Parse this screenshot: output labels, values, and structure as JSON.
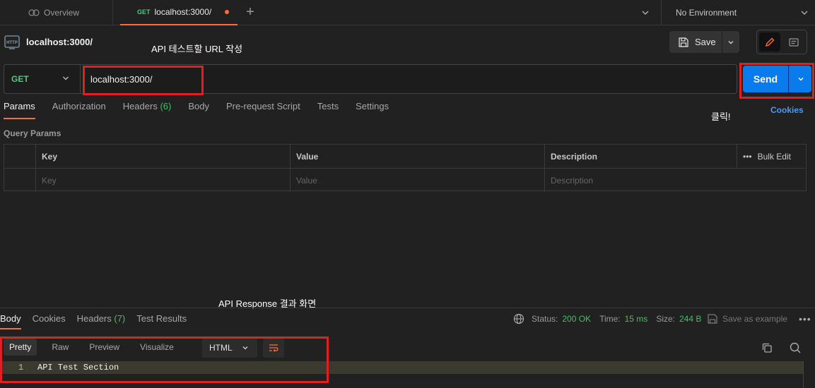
{
  "topbar": {
    "overview_label": "Overview",
    "active_tab": {
      "method": "GET",
      "label": "localhost:3000/"
    },
    "environment": "No Environment"
  },
  "request": {
    "title": "localhost:3000/",
    "method": "GET",
    "url": "localhost:3000/",
    "save_label": "Save",
    "send_label": "Send"
  },
  "annotations": {
    "url": "API 테스트할 URL 작성",
    "click": "클릭!",
    "response": "API Response 결과 화면"
  },
  "request_tabs": {
    "params": "Params",
    "authorization": "Authorization",
    "headers": "Headers",
    "headers_count": "(6)",
    "body": "Body",
    "prerequest": "Pre-request Script",
    "tests": "Tests",
    "settings": "Settings",
    "cookies": "Cookies"
  },
  "query_params": {
    "title": "Query Params",
    "columns": [
      "Key",
      "Value",
      "Description"
    ],
    "bulk_edit": "Bulk Edit",
    "placeholders": [
      "Key",
      "Value",
      "Description"
    ]
  },
  "response": {
    "tabs": {
      "body": "Body",
      "cookies": "Cookies",
      "headers": "Headers",
      "headers_count": "(7)",
      "test_results": "Test Results"
    },
    "status_label": "Status:",
    "status_value": "200 OK",
    "time_label": "Time:",
    "time_value": "15 ms",
    "size_label": "Size:",
    "size_value": "244 B",
    "save_example": "Save as example",
    "format_tabs": [
      "Pretty",
      "Raw",
      "Preview",
      "Visualize"
    ],
    "language": "HTML",
    "line_number": "1",
    "code": "API Test Section"
  },
  "colors": {
    "accent": "#ff6c37",
    "send": "#097bed",
    "success": "#4cbb66",
    "annotation": "#e02020"
  }
}
